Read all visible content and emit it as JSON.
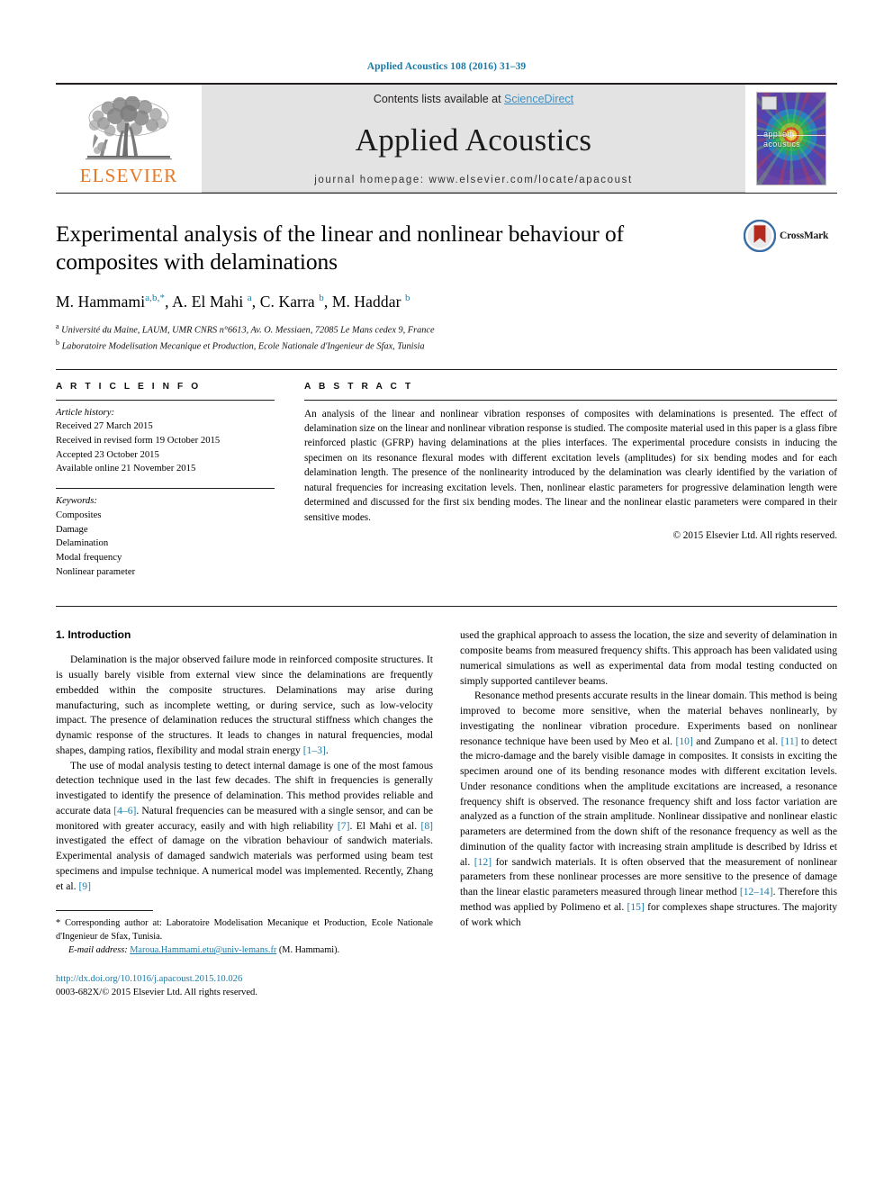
{
  "running_head": "Applied Acoustics 108 (2016) 31–39",
  "masthead": {
    "publisher": "ELSEVIER",
    "contents_prefix": "Contents lists available at ",
    "contents_link": "ScienceDirect",
    "journal_name": "Applied Acoustics",
    "homepage": "journal homepage: www.elsevier.com/locate/apacoust",
    "cover_title_line1": "applied",
    "cover_title_line2": "acoustics"
  },
  "article": {
    "title": "Experimental analysis of the linear and nonlinear behaviour of composites with delaminations",
    "authors_html": "M. Hammami<sup>a,b,*</sup>, A. El Mahi <sup>a</sup>, C. Karra <sup>b</sup>, M. Haddar <sup>b</sup>",
    "affiliation_a": "Université du Maine, LAUM, UMR CNRS n°6613, Av. O. Messiaen, 72085 Le Mans cedex 9, France",
    "affiliation_b": "Laboratoire Modelisation Mecanique et Production, Ecole Nationale d'Ingenieur de Sfax, Tunisia",
    "crossmark_label": "CrossMark"
  },
  "article_info": {
    "heading": "A R T I C L E    I N F O",
    "history_label": "Article history:",
    "history": [
      "Received 27 March 2015",
      "Received in revised form 19 October 2015",
      "Accepted 23 October 2015",
      "Available online 21 November 2015"
    ],
    "keywords_label": "Keywords:",
    "keywords": [
      "Composites",
      "Damage",
      "Delamination",
      "Modal frequency",
      "Nonlinear parameter"
    ]
  },
  "abstract": {
    "heading": "A B S T R A C T",
    "text": "An analysis of the linear and nonlinear vibration responses of composites with delaminations is presented. The effect of delamination size on the linear and nonlinear vibration response is studied. The composite material used in this paper is a glass fibre reinforced plastic (GFRP) having delaminations at the plies interfaces. The experimental procedure consists in inducing the specimen on its resonance flexural modes with different excitation levels (amplitudes) for six bending modes and for each delamination length. The presence of the nonlinearity introduced by the delamination was clearly identified by the variation of natural frequencies for increasing excitation levels. Then, nonlinear elastic parameters for progressive delamination length were determined and discussed for the first six bending modes. The linear and the nonlinear elastic parameters were compared in their sensitive modes.",
    "copyright": "© 2015 Elsevier Ltd. All rights reserved."
  },
  "body": {
    "section_title": "1. Introduction",
    "left_paragraphs": [
      "Delamination is the major observed failure mode in reinforced composite structures. It is usually barely visible from external view since the delaminations are frequently embedded within the composite structures. Delaminations may arise during manufacturing, such as incomplete wetting, or during service, such as low-velocity impact. The presence of delamination reduces the structural stiffness which changes the dynamic response of the structures. It leads to changes in natural frequencies, modal shapes, damping ratios, flexibility and modal strain energy [1–3].",
      "The use of modal analysis testing to detect internal damage is one of the most famous detection technique used in the last few decades. The shift in frequencies is generally investigated to identify the presence of delamination. This method provides reliable and accurate data [4–6]. Natural frequencies can be measured with a single sensor, and can be monitored with greater accuracy, easily and with high reliability [7]. El Mahi et al. [8] investigated the effect of damage on the vibration behaviour of sandwich materials. Experimental analysis of damaged sandwich materials was performed using beam test specimens and impulse technique. A numerical model was implemented. Recently, Zhang et al. [9]"
    ],
    "right_paragraphs": [
      "used the graphical approach to assess the location, the size and severity of delamination in composite beams from measured frequency shifts. This approach has been validated using numerical simulations as well as experimental data from modal testing conducted on simply supported cantilever beams.",
      "Resonance method presents accurate results in the linear domain. This method is being improved to become more sensitive, when the material behaves nonlinearly, by investigating the nonlinear vibration procedure. Experiments based on nonlinear resonance technique have been used by Meo et al. [10] and Zumpano et al. [11] to detect the micro-damage and the barely visible damage in composites. It consists in exciting the specimen around one of its bending resonance modes with different excitation levels. Under resonance conditions when the amplitude excitations are increased, a resonance frequency shift is observed. The resonance frequency shift and loss factor variation are analyzed as a function of the strain amplitude. Nonlinear dissipative and nonlinear elastic parameters are determined from the down shift of the resonance frequency as well as the diminution of the quality factor with increasing strain amplitude is described by Idriss et al. [12] for sandwich materials. It is often observed that the measurement of nonlinear parameters from these nonlinear processes are more sensitive to the presence of damage than the linear elastic parameters measured through linear method [12–14]. Therefore this method was applied by Polimeno et al. [15] for complexes shape structures. The majority of work which"
    ]
  },
  "footnote": {
    "star_marker": "*",
    "corresponding_text": "Corresponding author at: Laboratoire Modelisation Mecanique et Production, Ecole Nationale d'Ingenieur de Sfax, Tunisia.",
    "email_label": "E-mail address:",
    "email": "Maroua.Hammami.etu@univ-lemans.fr",
    "email_suffix": "(M. Hammami)."
  },
  "doi": {
    "url": "http://dx.doi.org/10.1016/j.apacoust.2015.10.026",
    "issn_line": "0003-682X/© 2015 Elsevier Ltd. All rights reserved."
  },
  "colors": {
    "link_blue": "#1a7ba8",
    "elsevier_orange": "#e87722",
    "masthead_gray": "#e3e3e3"
  }
}
